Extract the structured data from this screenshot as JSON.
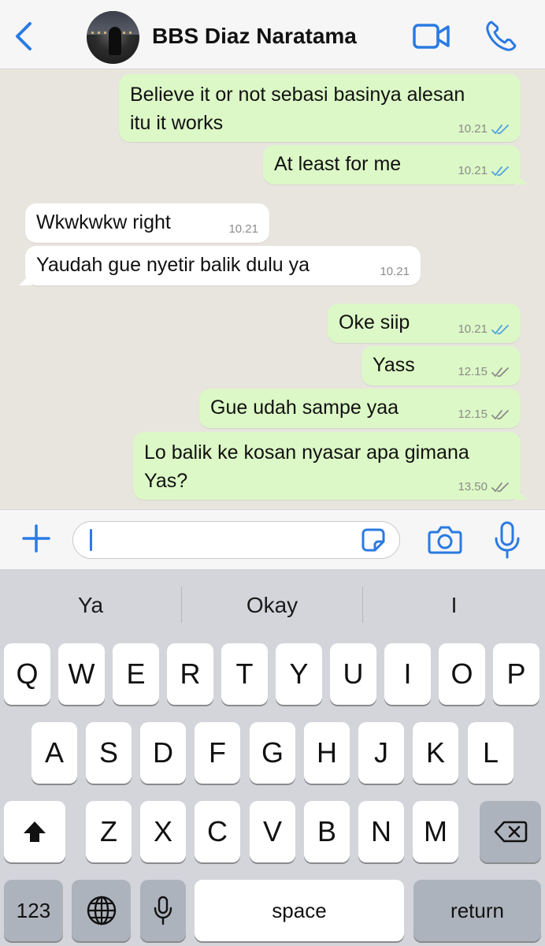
{
  "header": {
    "contact_name": "BBS Diaz Naratama",
    "icons": [
      "back-chevron-icon",
      "avatar",
      "video-camera-icon",
      "phone-icon"
    ],
    "accent_color": "#2a7ae2"
  },
  "messages": [
    {
      "direction": "out",
      "lines": [
        "Believe it or not sebasi basinya alesan",
        "itu it works"
      ],
      "time": "10.21",
      "status": "read"
    },
    {
      "direction": "out",
      "lines": [
        "At least for me"
      ],
      "time": "10.21",
      "status": "read"
    },
    {
      "direction": "in",
      "lines": [
        "Wkwkwkw right"
      ],
      "time": "10.21"
    },
    {
      "direction": "in",
      "lines": [
        "Yaudah gue nyetir balik dulu ya"
      ],
      "time": "10.21"
    },
    {
      "direction": "out",
      "lines": [
        "Oke siip"
      ],
      "time": "10.21",
      "status": "read"
    },
    {
      "direction": "out",
      "lines": [
        "Yass"
      ],
      "time": "12.15",
      "status": "delivered"
    },
    {
      "direction": "out",
      "lines": [
        "Gue udah sampe yaa"
      ],
      "time": "12.15",
      "status": "delivered"
    },
    {
      "direction": "out",
      "lines": [
        "Lo balik ke kosan nyasar apa gimana",
        "Yas?"
      ],
      "time": "13.50",
      "status": "delivered"
    }
  ],
  "input": {
    "value": "",
    "placeholder": ""
  },
  "keyboard": {
    "suggestions": [
      "Ya",
      "Okay",
      "I"
    ],
    "row1": [
      "Q",
      "W",
      "E",
      "R",
      "T",
      "Y",
      "U",
      "I",
      "O",
      "P"
    ],
    "row2": [
      "A",
      "S",
      "D",
      "F",
      "G",
      "H",
      "J",
      "K",
      "L"
    ],
    "row3": [
      "Z",
      "X",
      "C",
      "V",
      "B",
      "N",
      "M"
    ],
    "numbers_label": "123",
    "space_label": "space",
    "return_label": "return"
  },
  "colors": {
    "outgoing_bubble": "#dcf8c6",
    "incoming_bubble": "#ffffff",
    "chat_background": "#e8e5de",
    "read_ticks": "#4fa3e0",
    "unread_ticks": "#8b8b8b"
  }
}
